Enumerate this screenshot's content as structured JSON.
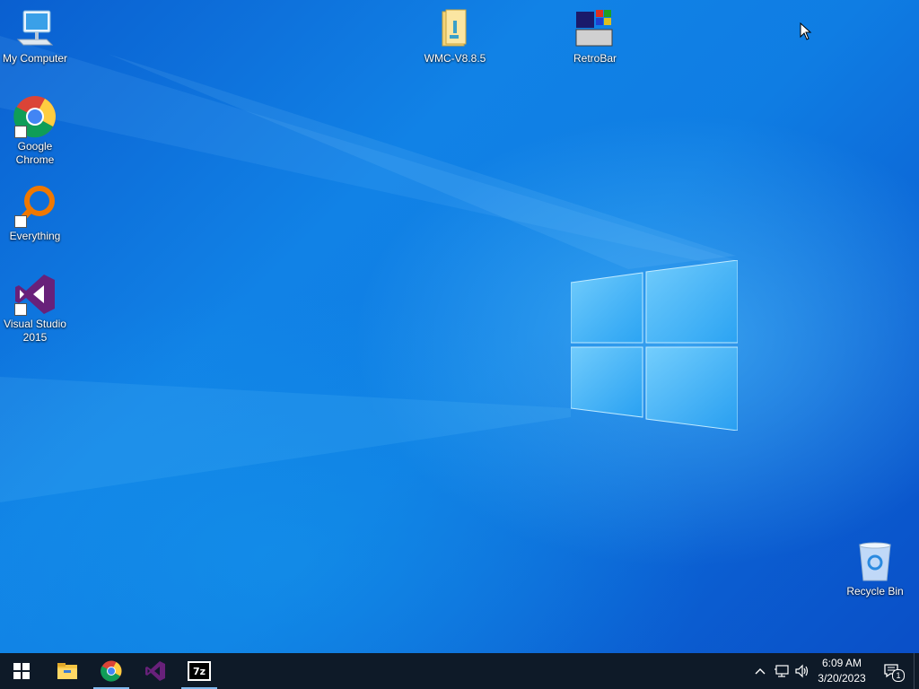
{
  "desktop": {
    "icons": [
      {
        "label": "My Computer",
        "icon": "computer-icon"
      },
      {
        "label": "Google\nChrome",
        "icon": "chrome-icon"
      },
      {
        "label": "Everything",
        "icon": "everything-search-icon"
      },
      {
        "label": "Visual Studio\n2015",
        "icon": "visual-studio-icon"
      },
      {
        "label": "WMC-V8.8.5",
        "icon": "folder-icon"
      },
      {
        "label": "RetroBar",
        "icon": "retrobar-icon"
      },
      {
        "label": "Recycle Bin",
        "icon": "recycle-bin-icon"
      }
    ]
  },
  "taskbar": {
    "start_icon": "windows-start-icon",
    "pinned": [
      {
        "name": "File Explorer",
        "icon": "file-explorer-icon"
      },
      {
        "name": "Google Chrome",
        "icon": "chrome-icon",
        "running": true
      },
      {
        "name": "Visual Studio",
        "icon": "visual-studio-icon"
      },
      {
        "name": "7-Zip",
        "icon": "7zip-icon",
        "text": "7z",
        "running": true
      }
    ],
    "tray": {
      "time": "6:09 AM",
      "date": "3/20/2023",
      "notification_count": "1"
    }
  },
  "colors": {
    "taskbar_bg": "#0e1a28",
    "desktop_accent": "#1182e6",
    "vs_purple": "#68217a"
  }
}
